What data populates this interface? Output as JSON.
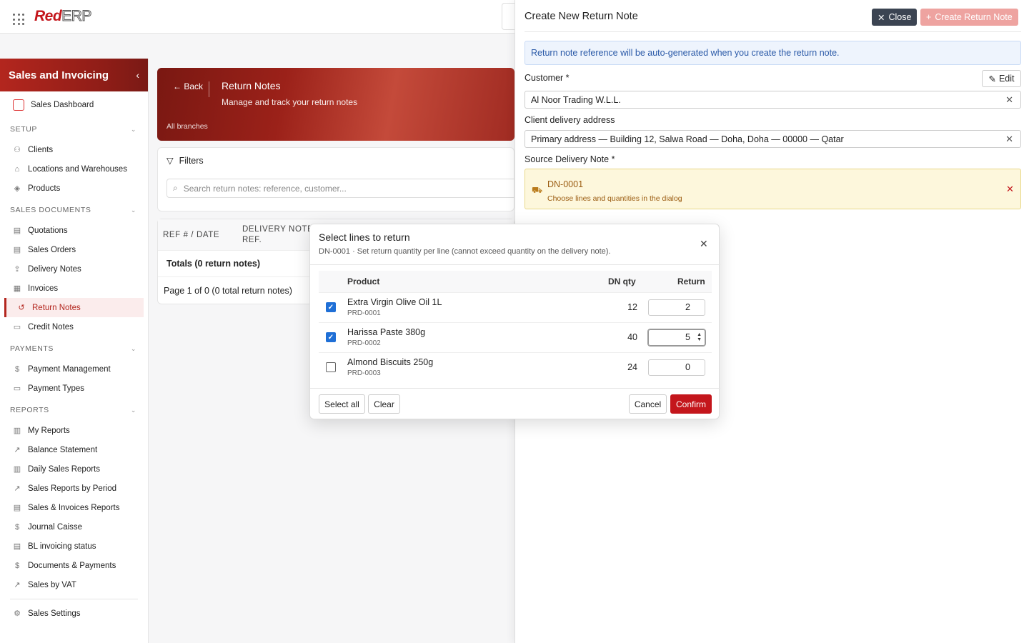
{
  "topbar": {
    "logo_red": "Red",
    "logo_erp": "ERP"
  },
  "sidebar": {
    "title": "Sales and Invoicing",
    "dashboard": "Sales Dashboard",
    "sections": [
      {
        "label": "SETUP",
        "items": [
          "Clients",
          "Locations and Warehouses",
          "Products"
        ]
      },
      {
        "label": "SALES DOCUMENTS",
        "items": [
          "Quotations",
          "Sales Orders",
          "Delivery Notes",
          "Invoices",
          "Return Notes",
          "Credit Notes"
        ]
      },
      {
        "label": "PAYMENTS",
        "items": [
          "Payment Management",
          "Payment Types"
        ]
      },
      {
        "label": "REPORTS",
        "items": [
          "My Reports",
          "Balance Statement",
          "Daily Sales Reports",
          "Sales Reports by Period",
          "Sales & Invoices Reports",
          "Journal Caisse",
          "BL invoicing status",
          "Documents & Payments",
          "Sales by VAT"
        ]
      }
    ],
    "settings": "Sales Settings",
    "active_item": "Return Notes"
  },
  "page": {
    "back_label": "Back",
    "title": "Return Notes",
    "subtitle": "Manage and track your return notes",
    "branches": "All branches",
    "filters_label": "Filters",
    "search_placeholder": "Search return notes: reference, customer...",
    "columns": [
      "REF # / DATE",
      "DELIVERY NOTE REF."
    ],
    "totals": "Totals (0 return notes)",
    "pagination": "Page 1 of 0 (0 total return notes)"
  },
  "drawer": {
    "title": "Create New Return Note",
    "close_label": "Close",
    "create_label": "Create Return Note",
    "info": "Return note reference will be auto-generated when you create the return note.",
    "customer_label": "Customer *",
    "edit_label": "Edit",
    "customer_value": "Al Noor Trading W.L.L.",
    "address_label": "Client delivery address",
    "address_value": "Primary address — Building 12, Salwa Road — Doha, Doha — 00000 — Qatar",
    "source_label": "Source Delivery Note *",
    "source_code": "DN-0001",
    "source_hint": "Choose lines and quantities in the dialog"
  },
  "modal": {
    "title": "Select lines to return",
    "subtitle": "DN-0001 · Set return quantity per line (cannot exceed quantity on the delivery note).",
    "headers": {
      "product": "Product",
      "dn_qty": "DN qty",
      "return": "Return"
    },
    "rows": [
      {
        "name": "Extra Virgin Olive Oil 1L",
        "sku": "PRD-0001",
        "dn_qty": "12",
        "return": "2",
        "checked": true
      },
      {
        "name": "Harissa Paste 380g",
        "sku": "PRD-0002",
        "dn_qty": "40",
        "return": "5",
        "checked": true
      },
      {
        "name": "Almond Biscuits 250g",
        "sku": "PRD-0003",
        "dn_qty": "24",
        "return": "0",
        "checked": false
      }
    ],
    "select_all": "Select all",
    "clear": "Clear",
    "cancel": "Cancel",
    "confirm": "Confirm"
  },
  "colors": {
    "brand_red": "#c4161c",
    "info_blue": "#2b5aa8",
    "warn_bg": "#fdf7dc"
  }
}
